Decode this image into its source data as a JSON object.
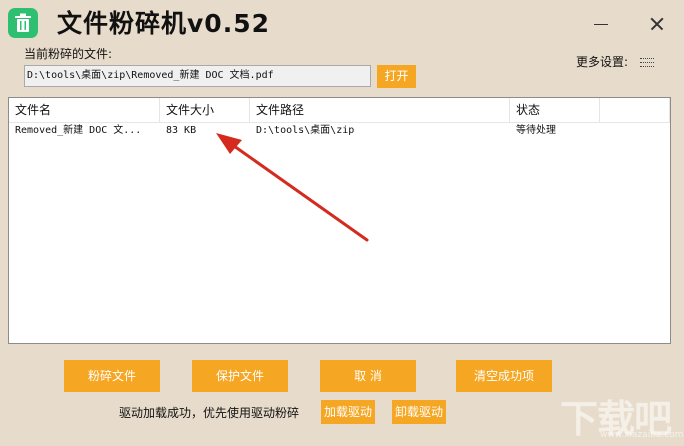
{
  "window": {
    "title": "文件粉碎机v0.52"
  },
  "current_file": {
    "label": "当前粉碎的文件:",
    "path": "D:\\tools\\桌面\\zip\\Removed_新建 DOC 文档.pdf",
    "open_label": "打开"
  },
  "settings": {
    "more_label": "更多设置:"
  },
  "table": {
    "columns": [
      "文件名",
      "文件大小",
      "文件路径",
      "状态",
      ""
    ],
    "rows": [
      {
        "name": "Removed_新建 DOC 文...",
        "size": "83  KB",
        "path": "D:\\tools\\桌面\\zip",
        "status": "等待处理"
      }
    ]
  },
  "actions": {
    "shred": "粉碎文件",
    "protect": "保护文件",
    "cancel": "取    消",
    "clear": "清空成功项",
    "load_driver": "加载驱动",
    "unload_driver": "卸载驱动"
  },
  "status": {
    "message": "驱动加载成功，优先使用驱动粉碎"
  },
  "watermark": {
    "text": "下载吧",
    "url": "www.xiazaiba.com"
  },
  "colors": {
    "background": "#e7dccb",
    "accent": "#f5a623",
    "annotation_arrow": "#d42a1f",
    "app_icon": "#2fbf71"
  }
}
